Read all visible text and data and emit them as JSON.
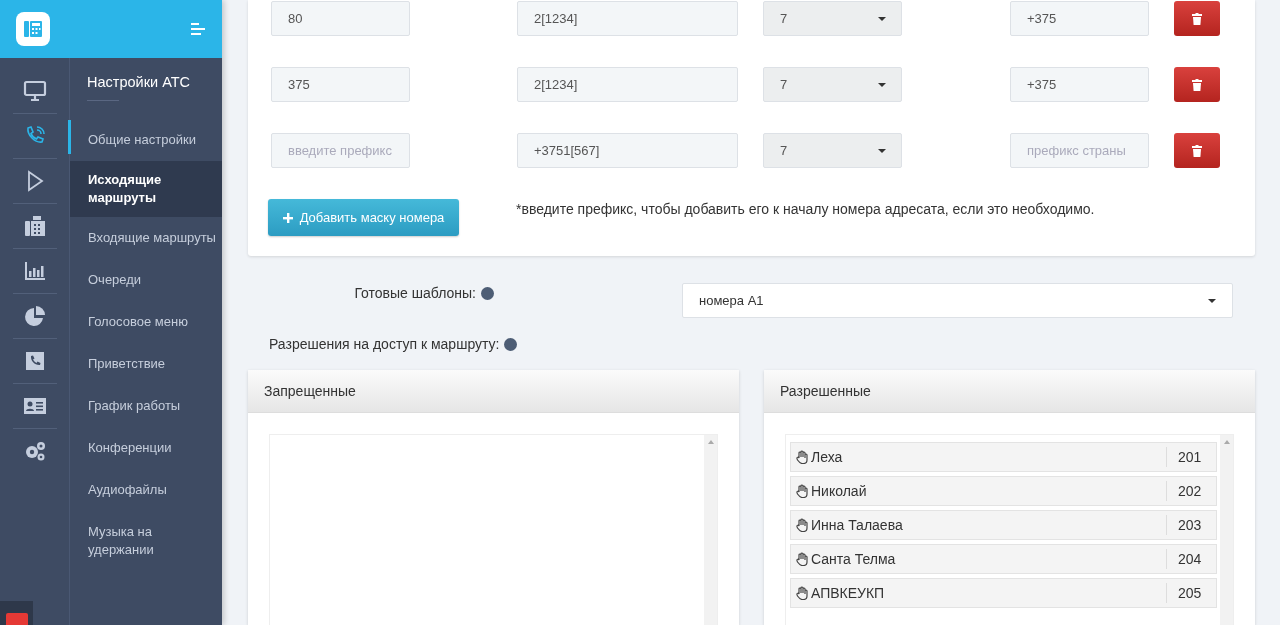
{
  "rail": [
    {
      "selected": false
    },
    {
      "selected": true
    },
    {
      "selected": false
    },
    {
      "selected": false
    },
    {
      "selected": false
    },
    {
      "selected": false
    },
    {
      "selected": false
    },
    {
      "selected": false
    },
    {
      "selected": false
    }
  ],
  "submenu": {
    "title": "Настройки АТС",
    "items": [
      {
        "label": "Общие настройки",
        "selected": false
      },
      {
        "label": "Исходящие маршруты",
        "selected": true
      },
      {
        "label": "Входящие маршруты",
        "selected": false
      },
      {
        "label": "Очереди",
        "selected": false
      },
      {
        "label": "Голосовое меню",
        "selected": false
      },
      {
        "label": "Приветствие",
        "selected": false
      },
      {
        "label": "График работы",
        "selected": false
      },
      {
        "label": "Конференции",
        "selected": false
      },
      {
        "label": "Аудиофайлы",
        "selected": false
      },
      {
        "label": "Музыка на удержании",
        "selected": false
      }
    ]
  },
  "masks": [
    {
      "prefix": {
        "value": "80"
      },
      "mask": "2[1234]",
      "digits": "7",
      "country": {
        "value": "+375"
      }
    },
    {
      "prefix": {
        "value": "375"
      },
      "mask": "2[1234]",
      "digits": "7",
      "country": {
        "value": "+375"
      }
    },
    {
      "prefix": {
        "placeholder": "введите префикс"
      },
      "mask": "+3751[567]",
      "digits": "7",
      "country": {
        "placeholder": "префикс страны"
      }
    }
  ],
  "add_button": "Добавить маску номера",
  "hint": "*введите префикс, чтобы добавить его к началу номера адресата, если это необходимо.",
  "templates": {
    "label": "Готовые шаблоны:",
    "value": "номера А1"
  },
  "permissions_label": "Разрешения на доступ к маршруту:",
  "denied": {
    "title": "Запрещенные"
  },
  "allowed": {
    "title": "Разрешенные",
    "items": [
      {
        "name": "Леха",
        "ext": "201"
      },
      {
        "name": "Николай",
        "ext": "202"
      },
      {
        "name": "Инна Талаева",
        "ext": "203"
      },
      {
        "name": "Санта Телма",
        "ext": "204"
      },
      {
        "name": "АПВКЕУКП",
        "ext": "205"
      }
    ]
  }
}
